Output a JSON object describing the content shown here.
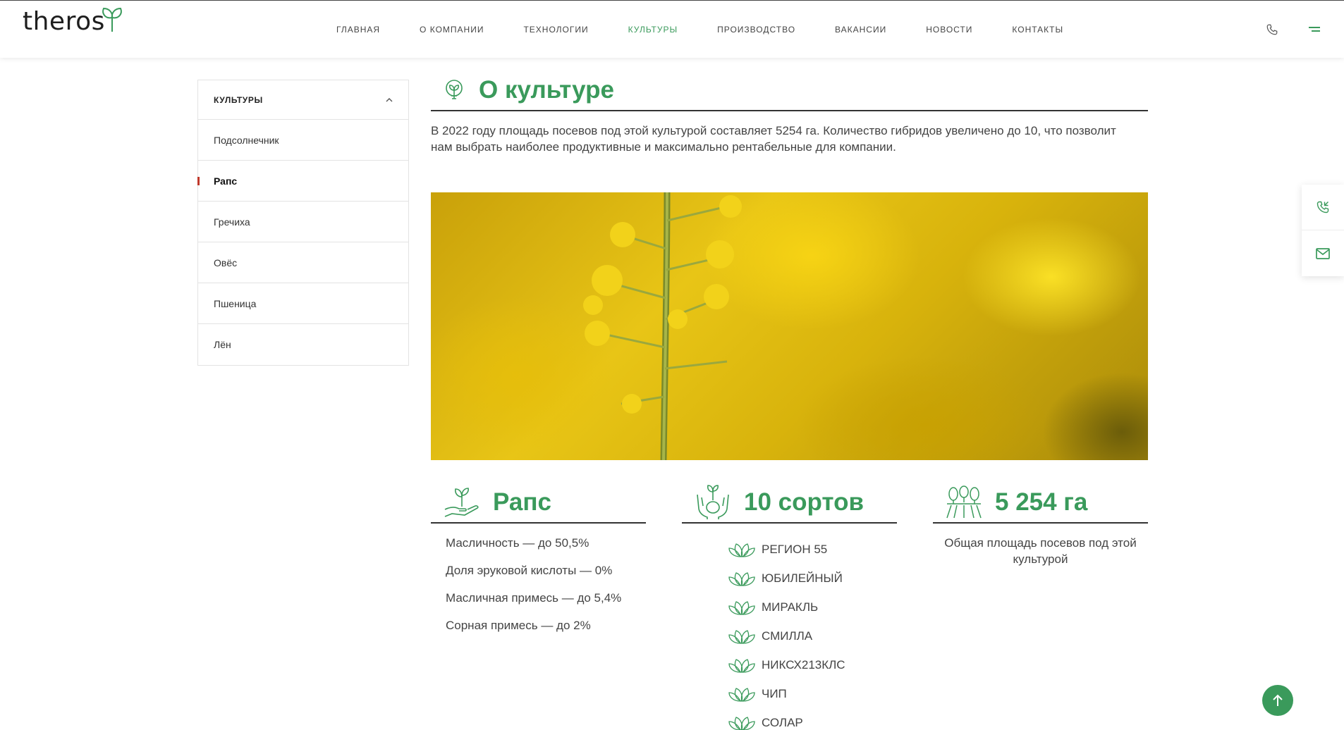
{
  "header": {
    "logo_text": "theros",
    "nav": [
      {
        "label": "ГЛАВНАЯ",
        "active": false
      },
      {
        "label": "О КОМПАНИИ",
        "active": false
      },
      {
        "label": "ТЕХНОЛОГИИ",
        "active": false
      },
      {
        "label": "КУЛЬТУРЫ",
        "active": true
      },
      {
        "label": "ПРОИЗВОДСТВО",
        "active": false
      },
      {
        "label": "ВАКАНСИИ",
        "active": false
      },
      {
        "label": "НОВОСТИ",
        "active": false
      },
      {
        "label": "КОНТАКТЫ",
        "active": false
      }
    ],
    "icons": [
      "phone-icon",
      "menu-icon"
    ]
  },
  "sidebar": {
    "title": "КУЛЬТУРЫ",
    "items": [
      {
        "label": "Подсолнечник",
        "active": false
      },
      {
        "label": "Рапс",
        "active": true
      },
      {
        "label": "Гречиха",
        "active": false
      },
      {
        "label": "Овёс",
        "active": false
      },
      {
        "label": "Пшеница",
        "active": false
      },
      {
        "label": "Лён",
        "active": false
      }
    ]
  },
  "about": {
    "title": "О культуре",
    "text": "В 2022 году площадь посевов под этой культурой составляет 5254 га. Количество гибридов увеличено до 10, что позволит нам выбрать наиболее продуктивные и максимально рентабельные для компании."
  },
  "stats": {
    "crop": {
      "title": "Рапс",
      "props": [
        "Масличность — до 50,5%",
        "Доля эруковой кислоты — 0%",
        "Масличная примесь — до 5,4%",
        "Сорная примесь — до 2%"
      ]
    },
    "sorts": {
      "title": "10 сортов",
      "items": [
        "РЕГИОН 55",
        "ЮБИЛЕЙНЫЙ",
        "МИРАКЛЬ",
        "СМИЛЛА",
        "НИКСХ213КЛС",
        "ЧИП",
        "СОЛАР"
      ]
    },
    "area": {
      "title": "5 254 га",
      "desc": "Общая площадь посевов под этой культурой"
    }
  },
  "colors": {
    "accent": "#3a9a5b",
    "active_marker": "#c0392b"
  }
}
